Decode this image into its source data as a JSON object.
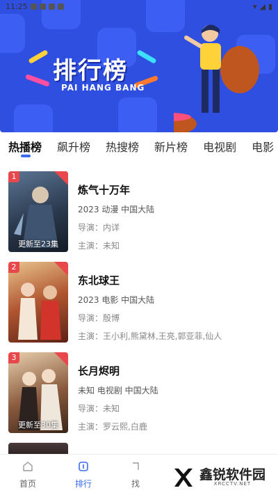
{
  "status_bar": {
    "time": "11:25"
  },
  "banner": {
    "title": "排行榜",
    "subtitle": "PAI HANG BANG"
  },
  "tabs": [
    "热播榜",
    "飙升榜",
    "热搜榜",
    "新片榜",
    "电视剧",
    "电影"
  ],
  "items": [
    {
      "rank": "1",
      "title": "炼气十万年",
      "meta": "2023  动漫  中国大陆",
      "director": "导演：内详",
      "cast": "主演：未知",
      "poster_text": "更新至23集",
      "colors": [
        "#2b3a4f",
        "#7c8fa6"
      ]
    },
    {
      "rank": "2",
      "title": "东北球王",
      "meta": "2023  电影  中国大陆",
      "director": "导演：殷博",
      "cast": "主演：王小利,熊黛林,王亮,郭亚菲,仙人",
      "poster_text": "",
      "colors": [
        "#8a3b2a",
        "#e2b67c"
      ]
    },
    {
      "rank": "3",
      "title": "长月烬明",
      "meta": "未知  电视剧  中国大陆",
      "director": "导演：未知",
      "cast": "主演：罗云熙,白鹿",
      "poster_text": "更新至30集",
      "colors": [
        "#5a3b2c",
        "#d6b58e"
      ]
    }
  ],
  "bottom_nav": [
    {
      "label": "首页",
      "icon": "home-icon",
      "active": false
    },
    {
      "label": "排行",
      "icon": "ranking-icon",
      "active": true
    },
    {
      "label": "找",
      "icon": "find-icon",
      "active": false
    }
  ],
  "watermark": {
    "name": "鑫锐软件园",
    "url": "XRCCTV.NET"
  }
}
